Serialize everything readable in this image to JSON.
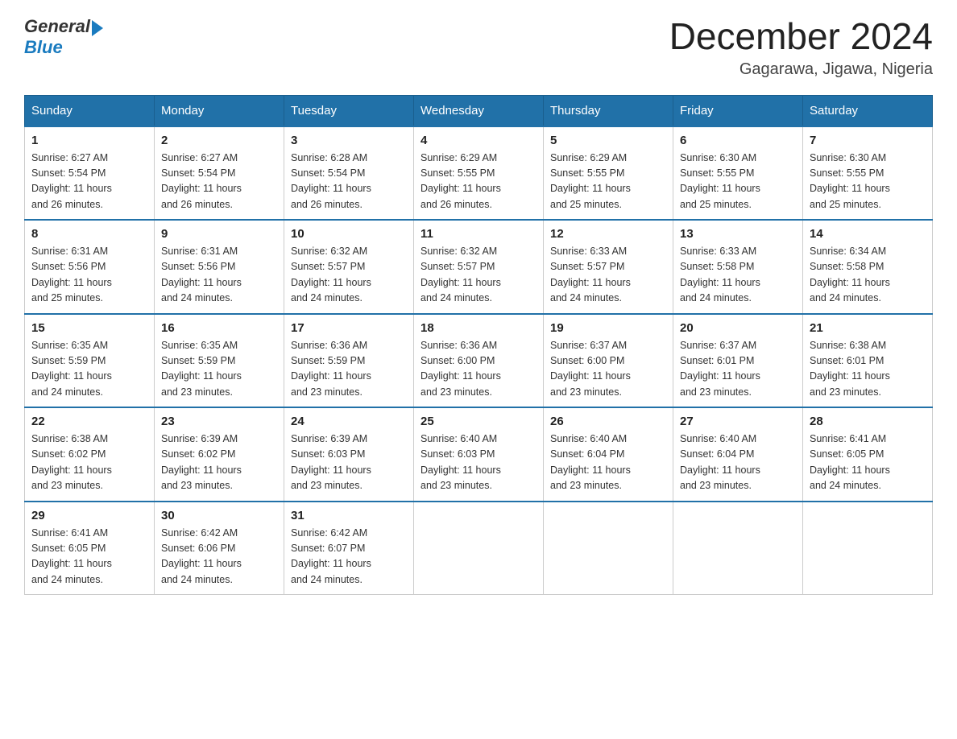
{
  "header": {
    "logo": {
      "general": "General",
      "blue": "Blue",
      "arrowLabel": "logo-arrow"
    },
    "title": "December 2024",
    "location": "Gagarawa, Jigawa, Nigeria"
  },
  "columns": [
    "Sunday",
    "Monday",
    "Tuesday",
    "Wednesday",
    "Thursday",
    "Friday",
    "Saturday"
  ],
  "weeks": [
    [
      {
        "day": "1",
        "sunrise": "6:27 AM",
        "sunset": "5:54 PM",
        "daylight": "11 hours and 26 minutes."
      },
      {
        "day": "2",
        "sunrise": "6:27 AM",
        "sunset": "5:54 PM",
        "daylight": "11 hours and 26 minutes."
      },
      {
        "day": "3",
        "sunrise": "6:28 AM",
        "sunset": "5:54 PM",
        "daylight": "11 hours and 26 minutes."
      },
      {
        "day": "4",
        "sunrise": "6:29 AM",
        "sunset": "5:55 PM",
        "daylight": "11 hours and 26 minutes."
      },
      {
        "day": "5",
        "sunrise": "6:29 AM",
        "sunset": "5:55 PM",
        "daylight": "11 hours and 25 minutes."
      },
      {
        "day": "6",
        "sunrise": "6:30 AM",
        "sunset": "5:55 PM",
        "daylight": "11 hours and 25 minutes."
      },
      {
        "day": "7",
        "sunrise": "6:30 AM",
        "sunset": "5:55 PM",
        "daylight": "11 hours and 25 minutes."
      }
    ],
    [
      {
        "day": "8",
        "sunrise": "6:31 AM",
        "sunset": "5:56 PM",
        "daylight": "11 hours and 25 minutes."
      },
      {
        "day": "9",
        "sunrise": "6:31 AM",
        "sunset": "5:56 PM",
        "daylight": "11 hours and 24 minutes."
      },
      {
        "day": "10",
        "sunrise": "6:32 AM",
        "sunset": "5:57 PM",
        "daylight": "11 hours and 24 minutes."
      },
      {
        "day": "11",
        "sunrise": "6:32 AM",
        "sunset": "5:57 PM",
        "daylight": "11 hours and 24 minutes."
      },
      {
        "day": "12",
        "sunrise": "6:33 AM",
        "sunset": "5:57 PM",
        "daylight": "11 hours and 24 minutes."
      },
      {
        "day": "13",
        "sunrise": "6:33 AM",
        "sunset": "5:58 PM",
        "daylight": "11 hours and 24 minutes."
      },
      {
        "day": "14",
        "sunrise": "6:34 AM",
        "sunset": "5:58 PM",
        "daylight": "11 hours and 24 minutes."
      }
    ],
    [
      {
        "day": "15",
        "sunrise": "6:35 AM",
        "sunset": "5:59 PM",
        "daylight": "11 hours and 24 minutes."
      },
      {
        "day": "16",
        "sunrise": "6:35 AM",
        "sunset": "5:59 PM",
        "daylight": "11 hours and 23 minutes."
      },
      {
        "day": "17",
        "sunrise": "6:36 AM",
        "sunset": "5:59 PM",
        "daylight": "11 hours and 23 minutes."
      },
      {
        "day": "18",
        "sunrise": "6:36 AM",
        "sunset": "6:00 PM",
        "daylight": "11 hours and 23 minutes."
      },
      {
        "day": "19",
        "sunrise": "6:37 AM",
        "sunset": "6:00 PM",
        "daylight": "11 hours and 23 minutes."
      },
      {
        "day": "20",
        "sunrise": "6:37 AM",
        "sunset": "6:01 PM",
        "daylight": "11 hours and 23 minutes."
      },
      {
        "day": "21",
        "sunrise": "6:38 AM",
        "sunset": "6:01 PM",
        "daylight": "11 hours and 23 minutes."
      }
    ],
    [
      {
        "day": "22",
        "sunrise": "6:38 AM",
        "sunset": "6:02 PM",
        "daylight": "11 hours and 23 minutes."
      },
      {
        "day": "23",
        "sunrise": "6:39 AM",
        "sunset": "6:02 PM",
        "daylight": "11 hours and 23 minutes."
      },
      {
        "day": "24",
        "sunrise": "6:39 AM",
        "sunset": "6:03 PM",
        "daylight": "11 hours and 23 minutes."
      },
      {
        "day": "25",
        "sunrise": "6:40 AM",
        "sunset": "6:03 PM",
        "daylight": "11 hours and 23 minutes."
      },
      {
        "day": "26",
        "sunrise": "6:40 AM",
        "sunset": "6:04 PM",
        "daylight": "11 hours and 23 minutes."
      },
      {
        "day": "27",
        "sunrise": "6:40 AM",
        "sunset": "6:04 PM",
        "daylight": "11 hours and 23 minutes."
      },
      {
        "day": "28",
        "sunrise": "6:41 AM",
        "sunset": "6:05 PM",
        "daylight": "11 hours and 24 minutes."
      }
    ],
    [
      {
        "day": "29",
        "sunrise": "6:41 AM",
        "sunset": "6:05 PM",
        "daylight": "11 hours and 24 minutes."
      },
      {
        "day": "30",
        "sunrise": "6:42 AM",
        "sunset": "6:06 PM",
        "daylight": "11 hours and 24 minutes."
      },
      {
        "day": "31",
        "sunrise": "6:42 AM",
        "sunset": "6:07 PM",
        "daylight": "11 hours and 24 minutes."
      },
      null,
      null,
      null,
      null
    ]
  ],
  "labels": {
    "sunrise": "Sunrise:",
    "sunset": "Sunset:",
    "daylight": "Daylight:"
  }
}
